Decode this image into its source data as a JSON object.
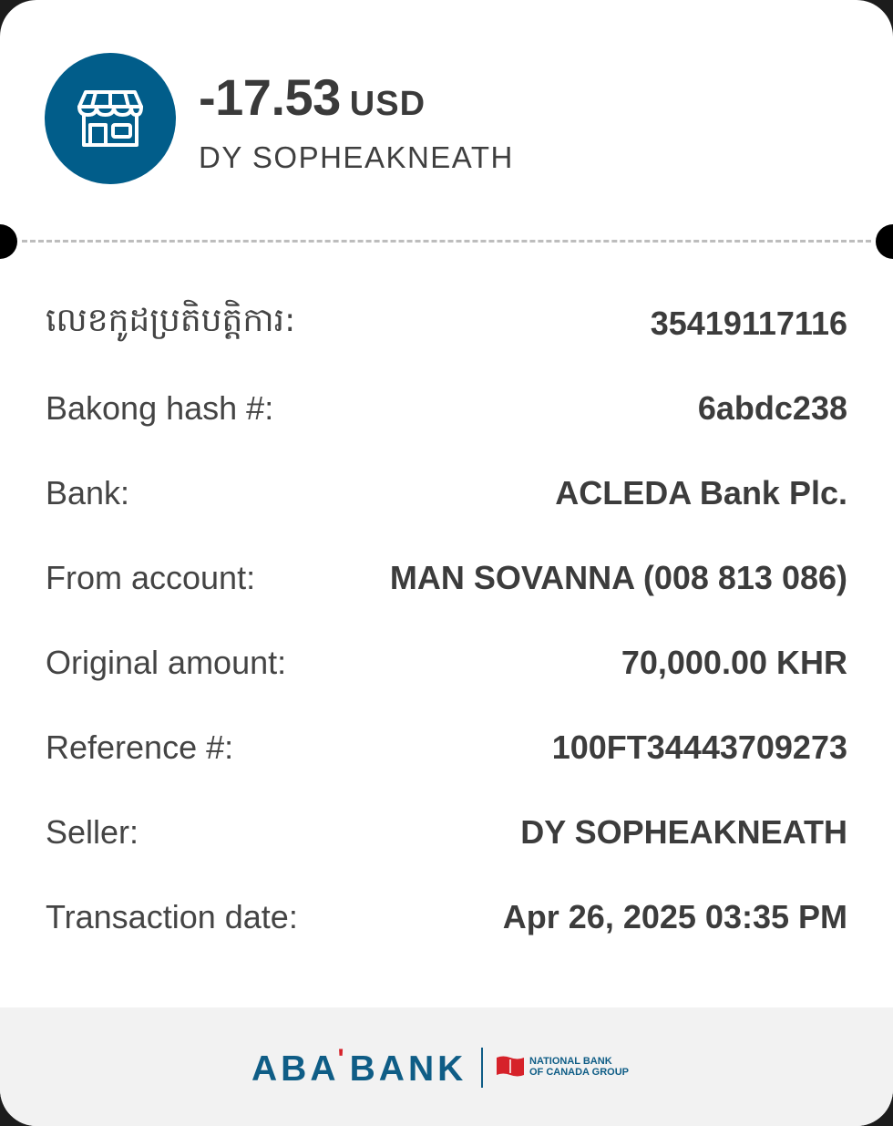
{
  "header": {
    "icon": "store-icon",
    "amount": "-17.53",
    "currency": "USD",
    "merchant_name": "DY SOPHEAKNEATH"
  },
  "details": [
    {
      "label": "លេខកូដប្រតិបត្តិការ:",
      "value": "35419117116"
    },
    {
      "label": "Bakong hash #:",
      "value": "6abdc238"
    },
    {
      "label": "Bank:",
      "value": "ACLEDA Bank Plc."
    },
    {
      "label": "From account:",
      "value": "MAN SOVANNA (008 813 086)"
    },
    {
      "label": "Original amount:",
      "value": "70,000.00 KHR"
    },
    {
      "label": "Reference #:",
      "value": "100FT34443709273"
    },
    {
      "label": "Seller:",
      "value": "DY SOPHEAKNEATH"
    },
    {
      "label": "Transaction date:",
      "value": "Apr 26, 2025 03:35 PM"
    }
  ],
  "footer": {
    "brand_left": "ABA",
    "brand_right": "BANK",
    "partner_line1": "NATIONAL BANK",
    "partner_line2": "OF CANADA GROUP"
  },
  "colors": {
    "brand_blue": "#015d8a",
    "accent_red": "#d6222a",
    "text_dark": "#3c3c3c"
  }
}
